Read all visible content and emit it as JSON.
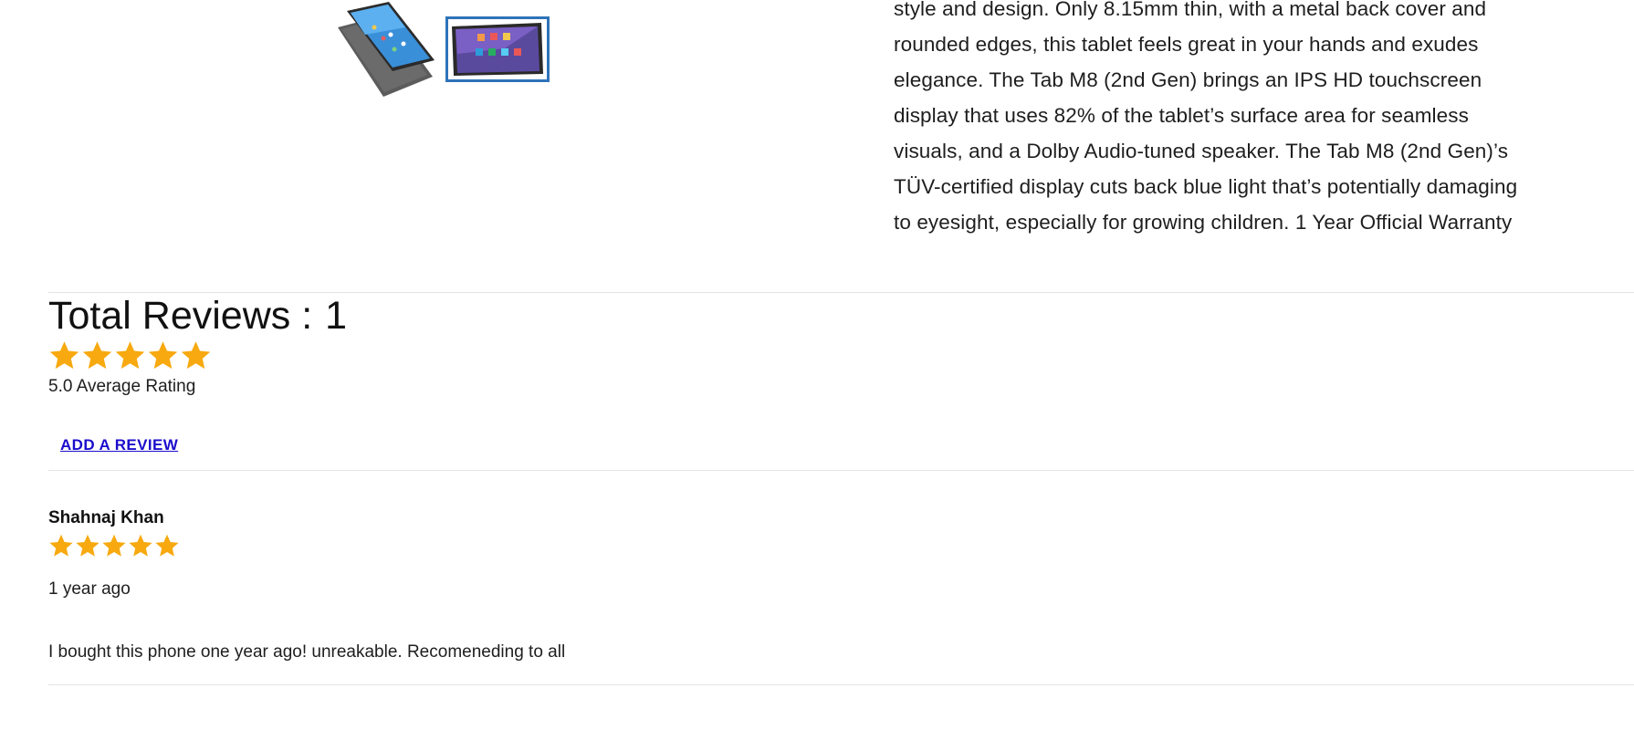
{
  "product": {
    "description_lines": [
      "style and design. Only 8.15mm thin, with a metal back cover and",
      "rounded edges, this tablet feels great in your hands and exudes",
      "elegance. The Tab M8 (2nd Gen) brings an IPS HD touchscreen",
      "display that uses 82% of the tablet’s surface area for seamless",
      "visuals, and a Dolby Audio-tuned speaker. The Tab M8 (2nd Gen)’s",
      "TÜV-certified display cuts back blue light that’s potentially damaging",
      "to eyesight, especially for growing children. 1 Year Official Warranty"
    ],
    "gallery": {
      "selected_index": 1,
      "accent_color": "#2f73b9"
    }
  },
  "reviews": {
    "total_label": "Total Reviews : ",
    "total_count": "1",
    "average_rating": 5.0,
    "average_label": "5.0 Average Rating",
    "star_color": "#f7a90f",
    "add_review_label": "ADD A REVIEW",
    "link_color": "#1a0dcc",
    "items": [
      {
        "author": "Shahnaj Khan",
        "rating": 5,
        "time": "1 year ago",
        "text": "I bought this phone one year ago! unreakable. Recomeneding to all"
      }
    ]
  }
}
